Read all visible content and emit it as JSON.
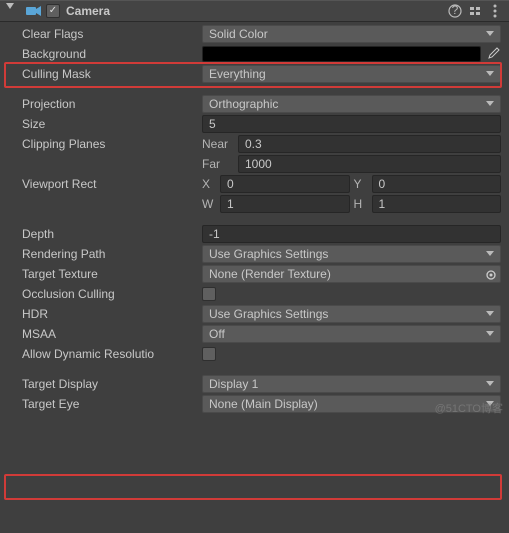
{
  "header": {
    "title": "Camera",
    "enabled": true
  },
  "clearFlags": {
    "label": "Clear Flags",
    "value": "Solid Color"
  },
  "background": {
    "label": "Background",
    "color": "#000000"
  },
  "cullingMask": {
    "label": "Culling Mask",
    "value": "Everything"
  },
  "projection": {
    "label": "Projection",
    "value": "Orthographic"
  },
  "size": {
    "label": "Size",
    "value": "5"
  },
  "clipping": {
    "label": "Clipping Planes",
    "nearLabel": "Near",
    "near": "0.3",
    "farLabel": "Far",
    "far": "1000"
  },
  "viewport": {
    "label": "Viewport Rect",
    "xLabel": "X",
    "x": "0",
    "yLabel": "Y",
    "y": "0",
    "wLabel": "W",
    "w": "1",
    "hLabel": "H",
    "h": "1"
  },
  "depth": {
    "label": "Depth",
    "value": "-1"
  },
  "renderingPath": {
    "label": "Rendering Path",
    "value": "Use Graphics Settings"
  },
  "targetTexture": {
    "label": "Target Texture",
    "value": "None (Render Texture)"
  },
  "occlusion": {
    "label": "Occlusion Culling",
    "checked": false
  },
  "hdr": {
    "label": "HDR",
    "value": "Use Graphics Settings"
  },
  "msaa": {
    "label": "MSAA",
    "value": "Off"
  },
  "allowDynRes": {
    "label": "Allow Dynamic Resolutio",
    "checked": false
  },
  "targetDisplay": {
    "label": "Target Display",
    "value": "Display 1"
  },
  "targetEye": {
    "label": "Target Eye",
    "value": "None (Main Display)"
  },
  "watermark": "@51CTO博客"
}
